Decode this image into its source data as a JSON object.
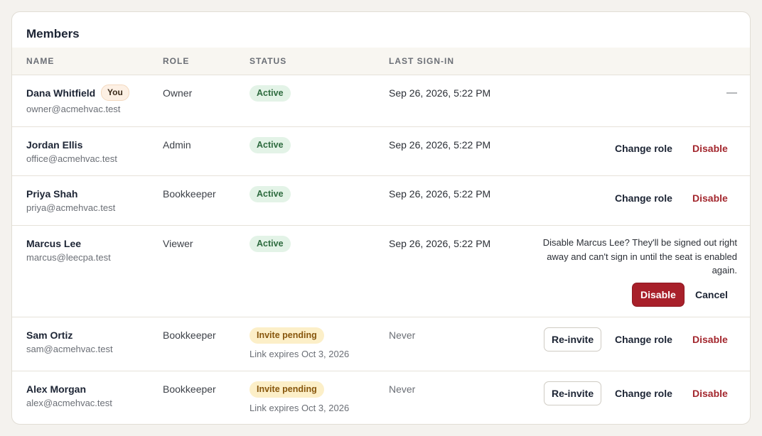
{
  "card": {
    "title": "Members"
  },
  "columns": {
    "name": "NAME",
    "role": "ROLE",
    "status": "STATUS",
    "last_signin": "LAST SIGN-IN"
  },
  "members": [
    {
      "name": "Dana Whitfield",
      "badge": "You",
      "email": "owner@acmehvac.test",
      "role": "Owner",
      "status": "Active",
      "last_signin": "Sep 26, 2026, 5:22 PM",
      "actions_placeholder": "—"
    },
    {
      "name": "Jordan Ellis",
      "email": "office@acmehvac.test",
      "role": "Admin",
      "status": "Active",
      "last_signin": "Sep 26, 2026, 5:22 PM",
      "change_role": "Change role",
      "disable": "Disable"
    },
    {
      "name": "Priya Shah",
      "email": "priya@acmehvac.test",
      "role": "Bookkeeper",
      "status": "Active",
      "last_signin": "Sep 26, 2026, 5:22 PM",
      "change_role": "Change role",
      "disable": "Disable"
    },
    {
      "name": "Marcus Lee",
      "email": "marcus@leecpa.test",
      "role": "Viewer",
      "status": "Active",
      "last_signin": "Sep 26, 2026, 5:22 PM",
      "confirm_message": "Disable Marcus Lee? They'll be signed out right away and can't sign in until the seat is enabled again.",
      "confirm_disable": "Disable",
      "cancel": "Cancel"
    },
    {
      "name": "Sam Ortiz",
      "email": "sam@acmehvac.test",
      "role": "Bookkeeper",
      "status": "Invite pending",
      "expires": "Link expires Oct 3, 2026",
      "last_signin": "Never",
      "reinvite": "Re-invite",
      "change_role": "Change role",
      "disable": "Disable"
    },
    {
      "name": "Alex Morgan",
      "email": "alex@acmehvac.test",
      "role": "Bookkeeper",
      "status": "Invite pending",
      "expires": "Link expires Oct 3, 2026",
      "last_signin": "Never",
      "reinvite": "Re-invite",
      "change_role": "Change role",
      "disable": "Disable"
    }
  ],
  "colors": {
    "active_bg": "#e3f3e7",
    "active_text": "#2e6b3f",
    "pending_bg": "#fcefc8",
    "pending_text": "#87560c",
    "danger": "#a8202a"
  }
}
